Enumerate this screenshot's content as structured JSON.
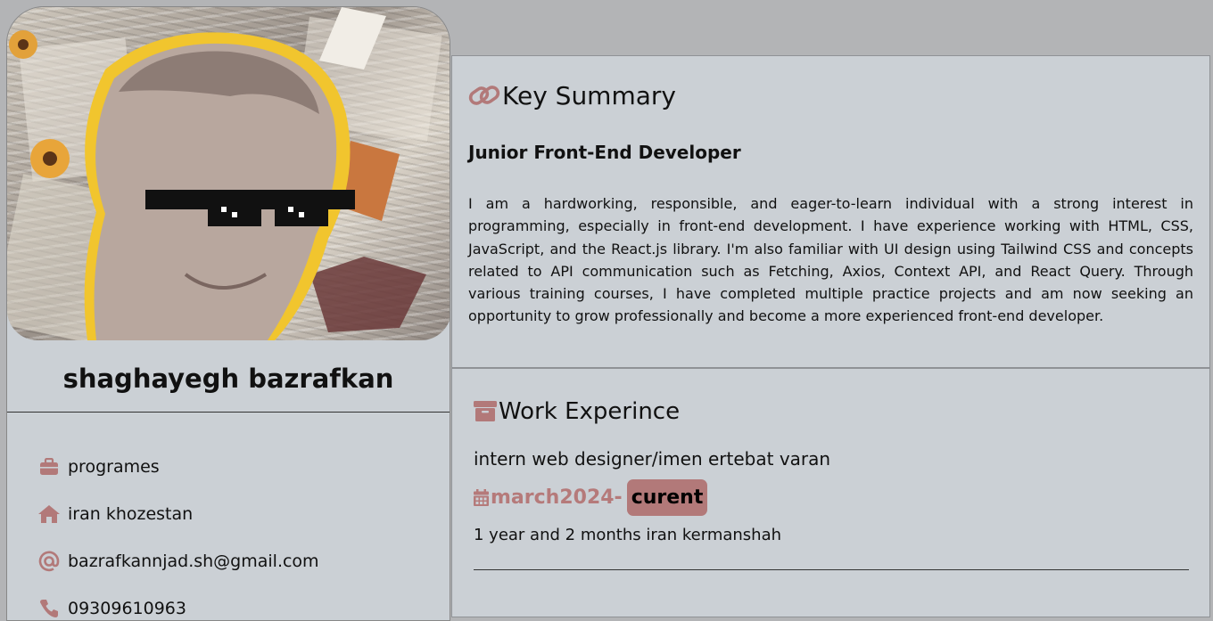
{
  "profile": {
    "name": "shaghayegh bazrafkan",
    "info": [
      {
        "icon": "briefcase-icon",
        "text": "programes"
      },
      {
        "icon": "home-icon",
        "text": "iran khozestan"
      },
      {
        "icon": "at-sign-icon",
        "text": "bazrafkannjad.sh@gmail.com"
      },
      {
        "icon": "phone-icon",
        "text": "09309610963"
      }
    ]
  },
  "summary": {
    "heading": "Key Summary",
    "role": "Junior Front-End Developer",
    "text": "I am a hardworking, responsible, and eager-to-learn individual with a strong interest in programming, especially in front-end development. I have experience working with HTML, CSS, JavaScript, and the React.js library. I'm also familiar with UI design using Tailwind CSS and concepts related to API communication such as Fetching, Axios, Context API, and React Query. Through various training courses, I have completed multiple practice projects and am now seeking an opportunity to grow professionally and become a more experienced front-end developer."
  },
  "work": {
    "heading": "Work Experince",
    "job_title": "intern web designer/imen ertebat varan",
    "start": "march2024-",
    "end": "curent",
    "duration": "1 year and 2 months iran kermanshah"
  },
  "colors": {
    "accent": "#b27979",
    "panel_bg": "#cbd0d5",
    "page_bg": "#b3b4b6"
  }
}
